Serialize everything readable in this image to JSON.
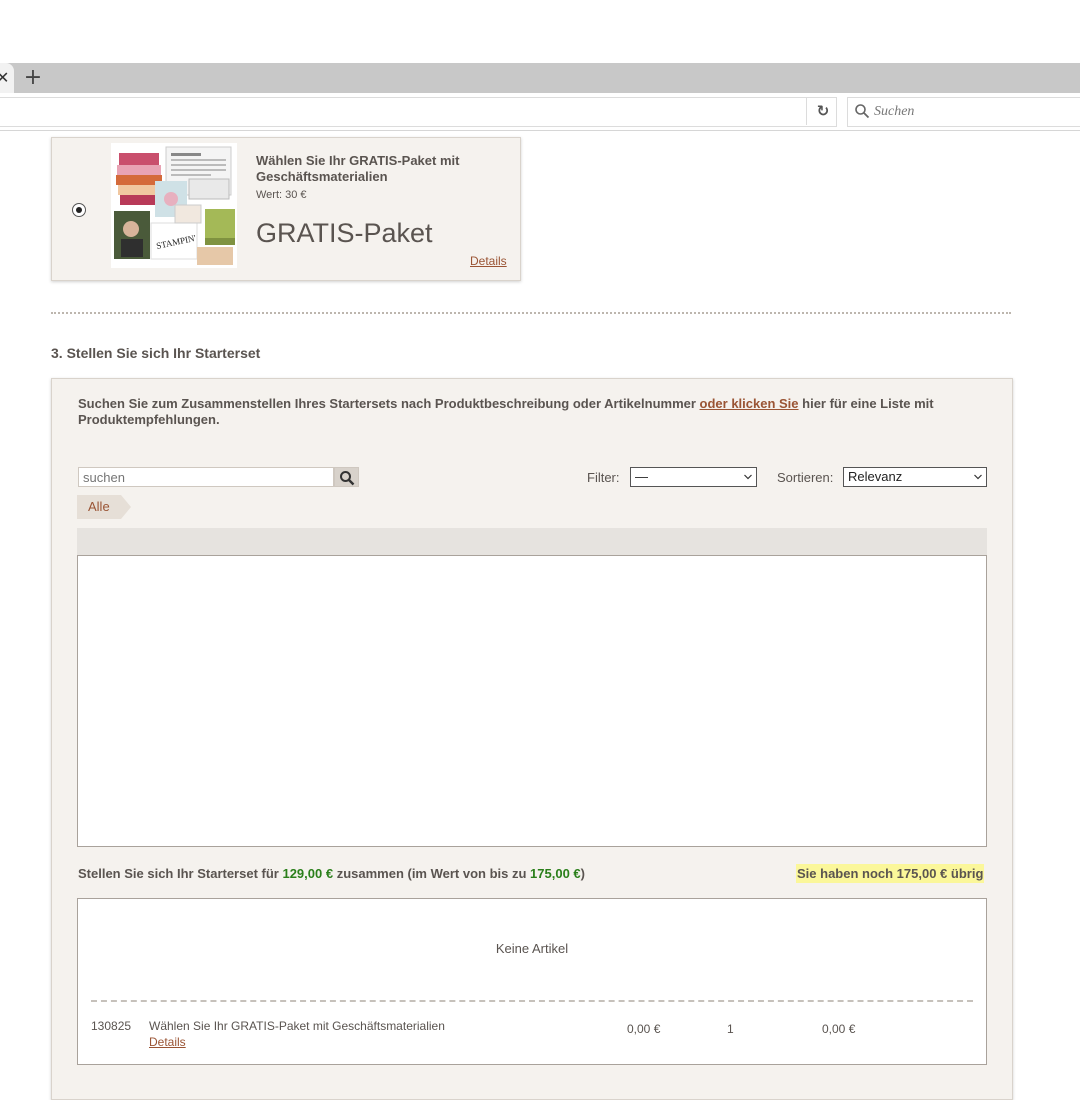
{
  "browser": {
    "new_tab_symbol": "+",
    "close_symbol": "✕",
    "reload_symbol": "↻",
    "search_placeholder": "Suchen",
    "icons": [
      "close-icon",
      "plus-icon",
      "reload-icon",
      "search-icon"
    ]
  },
  "gift": {
    "title": "Wählen Sie Ihr GRATIS-Paket mit Geschäftsmaterialien",
    "worth": "Wert: 30 €",
    "name": "GRATIS-Paket",
    "details_link": "Details",
    "selected": true
  },
  "section": {
    "title": "3. Stellen Sie sich Ihr Starterset"
  },
  "builder": {
    "intro_before": "Suchen Sie zum Zusammenstellen Ihres Startersets nach Produktbeschreibung oder Artikelnummer ",
    "intro_link": "oder klicken Sie",
    "intro_after": " hier für eine Liste mit Produktempfehlungen.",
    "search_placeholder": "suchen",
    "filter_label": "Filter:",
    "filter_value": "—",
    "sort_label": "Sortieren:",
    "sort_value": "Relevanz",
    "crumb": "Alle",
    "budget_prefix": "Stellen Sie sich Ihr Starterset für ",
    "budget_price": "129,00 €",
    "budget_mid": " zusammen (im Wert von bis zu ",
    "budget_value": "175,00 €",
    "budget_suffix": ")",
    "remaining": "Sie haben noch 175,00 € übrig",
    "colors": {
      "accent_link": "#9a5434",
      "price_green": "#2a7f1a",
      "highlight": "#fbf79a"
    }
  },
  "cart": {
    "empty_text": "Keine Artikel",
    "rows": [
      {
        "sku": "130825",
        "name": "Wählen Sie Ihr GRATIS-Paket mit Geschäftsmaterialien",
        "details": "Details",
        "price": "0,00 €",
        "qty": "1",
        "total": "0,00 €"
      }
    ]
  }
}
